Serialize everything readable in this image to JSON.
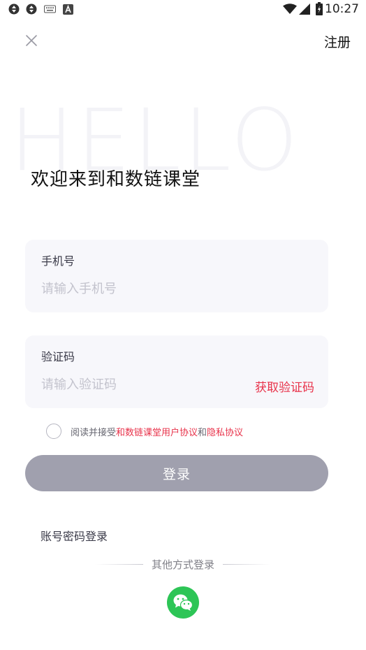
{
  "status_bar": {
    "time": "10:27",
    "icons": [
      "sync-icon",
      "sync-icon",
      "keyboard-icon",
      "font-icon",
      "wifi-icon",
      "signal-icon",
      "battery-icon"
    ]
  },
  "header": {
    "close_icon": "close-icon",
    "register_label": "注册"
  },
  "hero": {
    "watermark": "HELLO",
    "title": "欢迎来到和数链课堂"
  },
  "phone_field": {
    "label": "手机号",
    "placeholder": "请输入手机号",
    "value": ""
  },
  "code_field": {
    "label": "验证码",
    "placeholder": "请输入验证码",
    "value": "",
    "get_code_label": "获取验证码"
  },
  "agreement": {
    "prefix": "阅读并接受",
    "user_agreement": "和数链课堂用户协议",
    "conjunction": "和",
    "privacy_policy": "隐私协议",
    "checked": false
  },
  "login_button": {
    "label": "登录"
  },
  "password_login_label": "账号密码登录",
  "other_methods_label": "其他方式登录",
  "social": {
    "icon": "wechat-icon"
  },
  "colors": {
    "accent": "#e8324a",
    "button_disabled": "#a0a0ae",
    "wechat": "#2dc556",
    "field_bg": "#f7f7fb"
  }
}
